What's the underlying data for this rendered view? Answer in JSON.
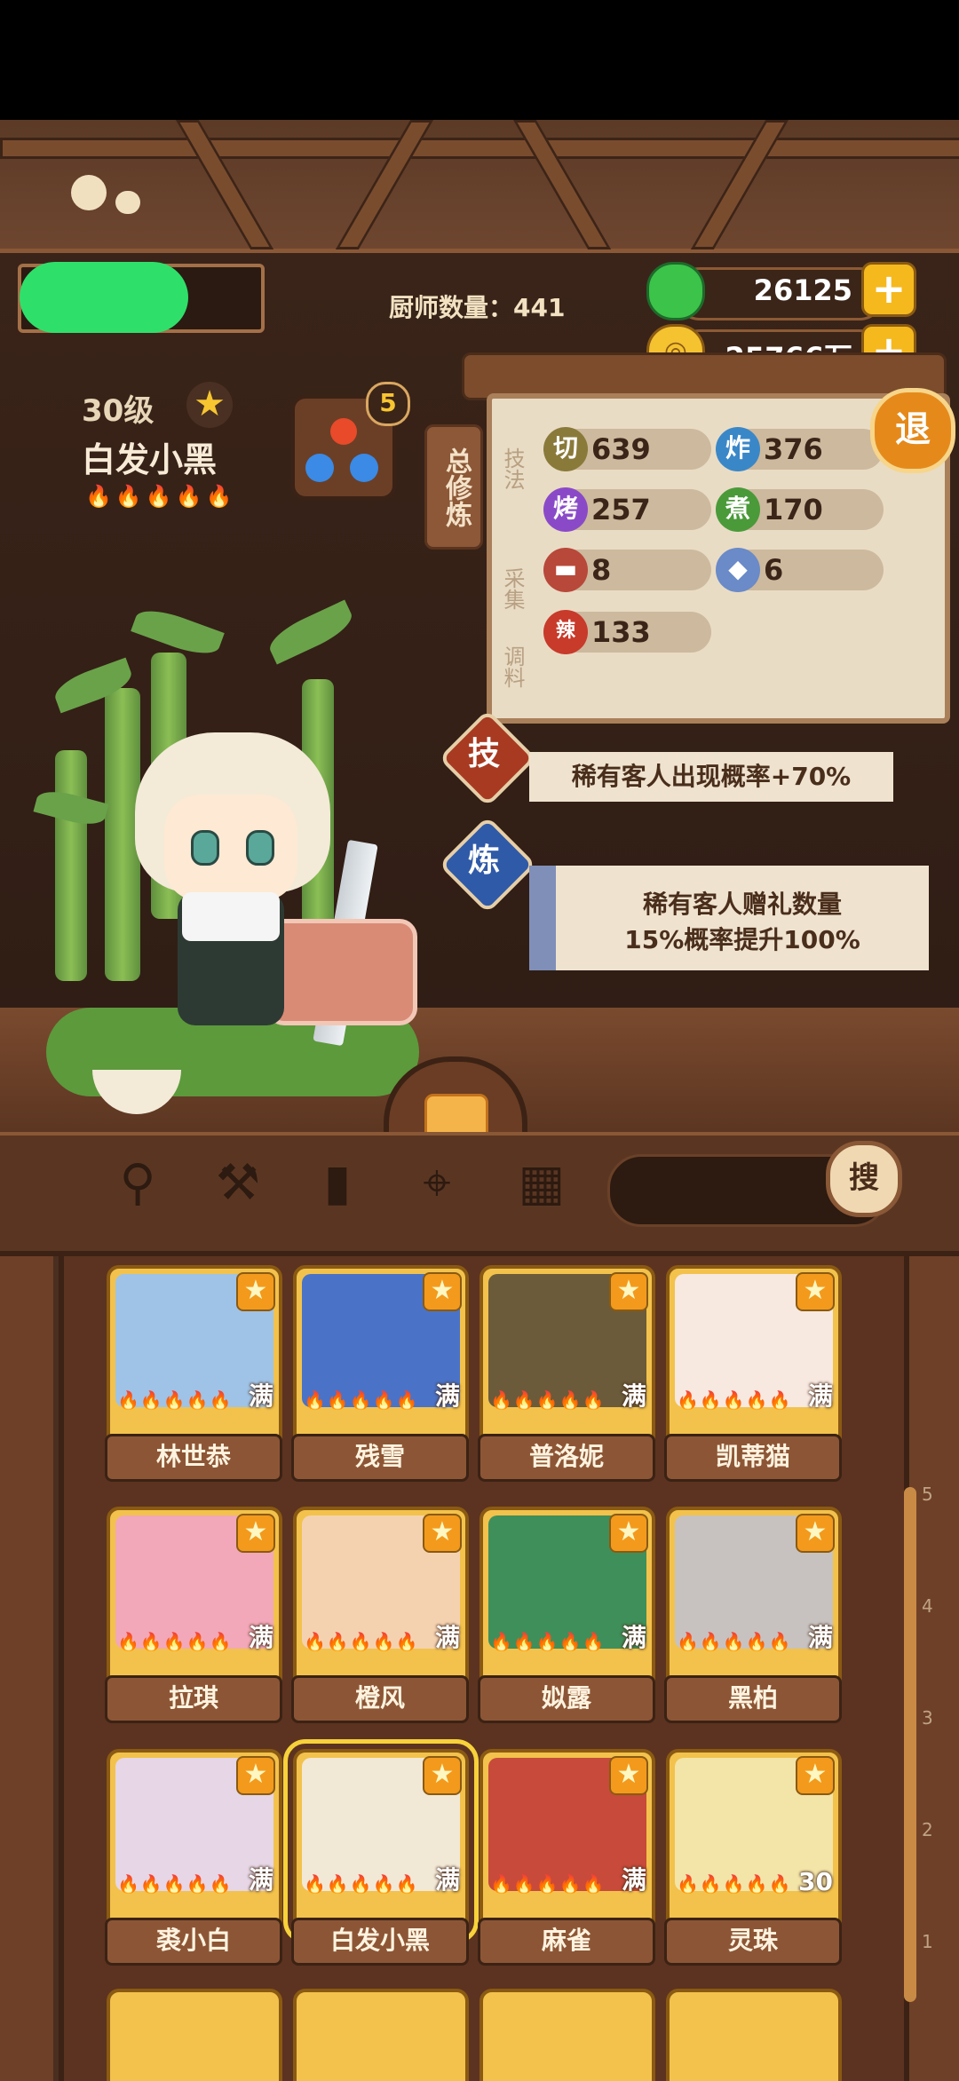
{
  "header": {
    "chef_count": "厨师数量：441",
    "jade_value": "26125",
    "coin_value": "25766万",
    "plus_label": "+"
  },
  "chef": {
    "level": "30级",
    "name": "白发小黑",
    "flames": "🔥🔥🔥🔥🔥",
    "gem_count": "5"
  },
  "panel": {
    "tab_label": "总修炼",
    "exit_label": "退",
    "section_skill": "技法",
    "section_gather": "采集",
    "section_season": "调料",
    "stats": [
      {
        "icon": "切",
        "value": "639",
        "color": "#8a7a3a"
      },
      {
        "icon": "炸",
        "value": "376",
        "color": "#3a87c8"
      },
      {
        "icon": "烤",
        "value": "257",
        "color": "#8a4ac8"
      },
      {
        "icon": "煮",
        "value": "170",
        "color": "#4a9a3a"
      },
      {
        "icon": "",
        "value": "8",
        "color": "#b8483a"
      },
      {
        "icon": "",
        "value": "6",
        "color": "#6a8ac8"
      },
      {
        "icon": "辣",
        "value": "133",
        "color": "#c83a2a"
      }
    ],
    "skill_btn": "技",
    "train_btn": "炼",
    "banner1": "稀有客人出现概率+70%",
    "banner2_line1": "稀有客人赠礼数量",
    "banner2_line2": "15%概率提升100%"
  },
  "toolbar": {
    "search_label": "搜"
  },
  "cards": [
    {
      "name": "林世恭",
      "badge": "满",
      "color": "#9fc3e6"
    },
    {
      "name": "残雪",
      "badge": "满",
      "color": "#4a73c8"
    },
    {
      "name": "普洛妮",
      "badge": "满",
      "color": "#6b5b3a"
    },
    {
      "name": "凯蒂猫",
      "badge": "满",
      "color": "#f7e8e0"
    },
    {
      "name": "拉琪",
      "badge": "满",
      "color": "#f2a8b8"
    },
    {
      "name": "橙风",
      "badge": "满",
      "color": "#f4d2b0"
    },
    {
      "name": "姒露",
      "badge": "满",
      "color": "#3f8f5a"
    },
    {
      "name": "黑柏",
      "badge": "满",
      "color": "#c7c2c0"
    },
    {
      "name": "裘小白",
      "badge": "满",
      "color": "#e6d6e6"
    },
    {
      "name": "白发小黑",
      "badge": "满",
      "color": "#f2e8d6"
    },
    {
      "name": "麻雀",
      "badge": "满",
      "color": "#c84a3a"
    },
    {
      "name": "灵珠",
      "badge": "30",
      "color": "#f3e4a8"
    }
  ],
  "card_flames": "🔥🔥🔥🔥🔥",
  "ruler_ticks": [
    "5",
    "4",
    "3",
    "2",
    "1"
  ]
}
